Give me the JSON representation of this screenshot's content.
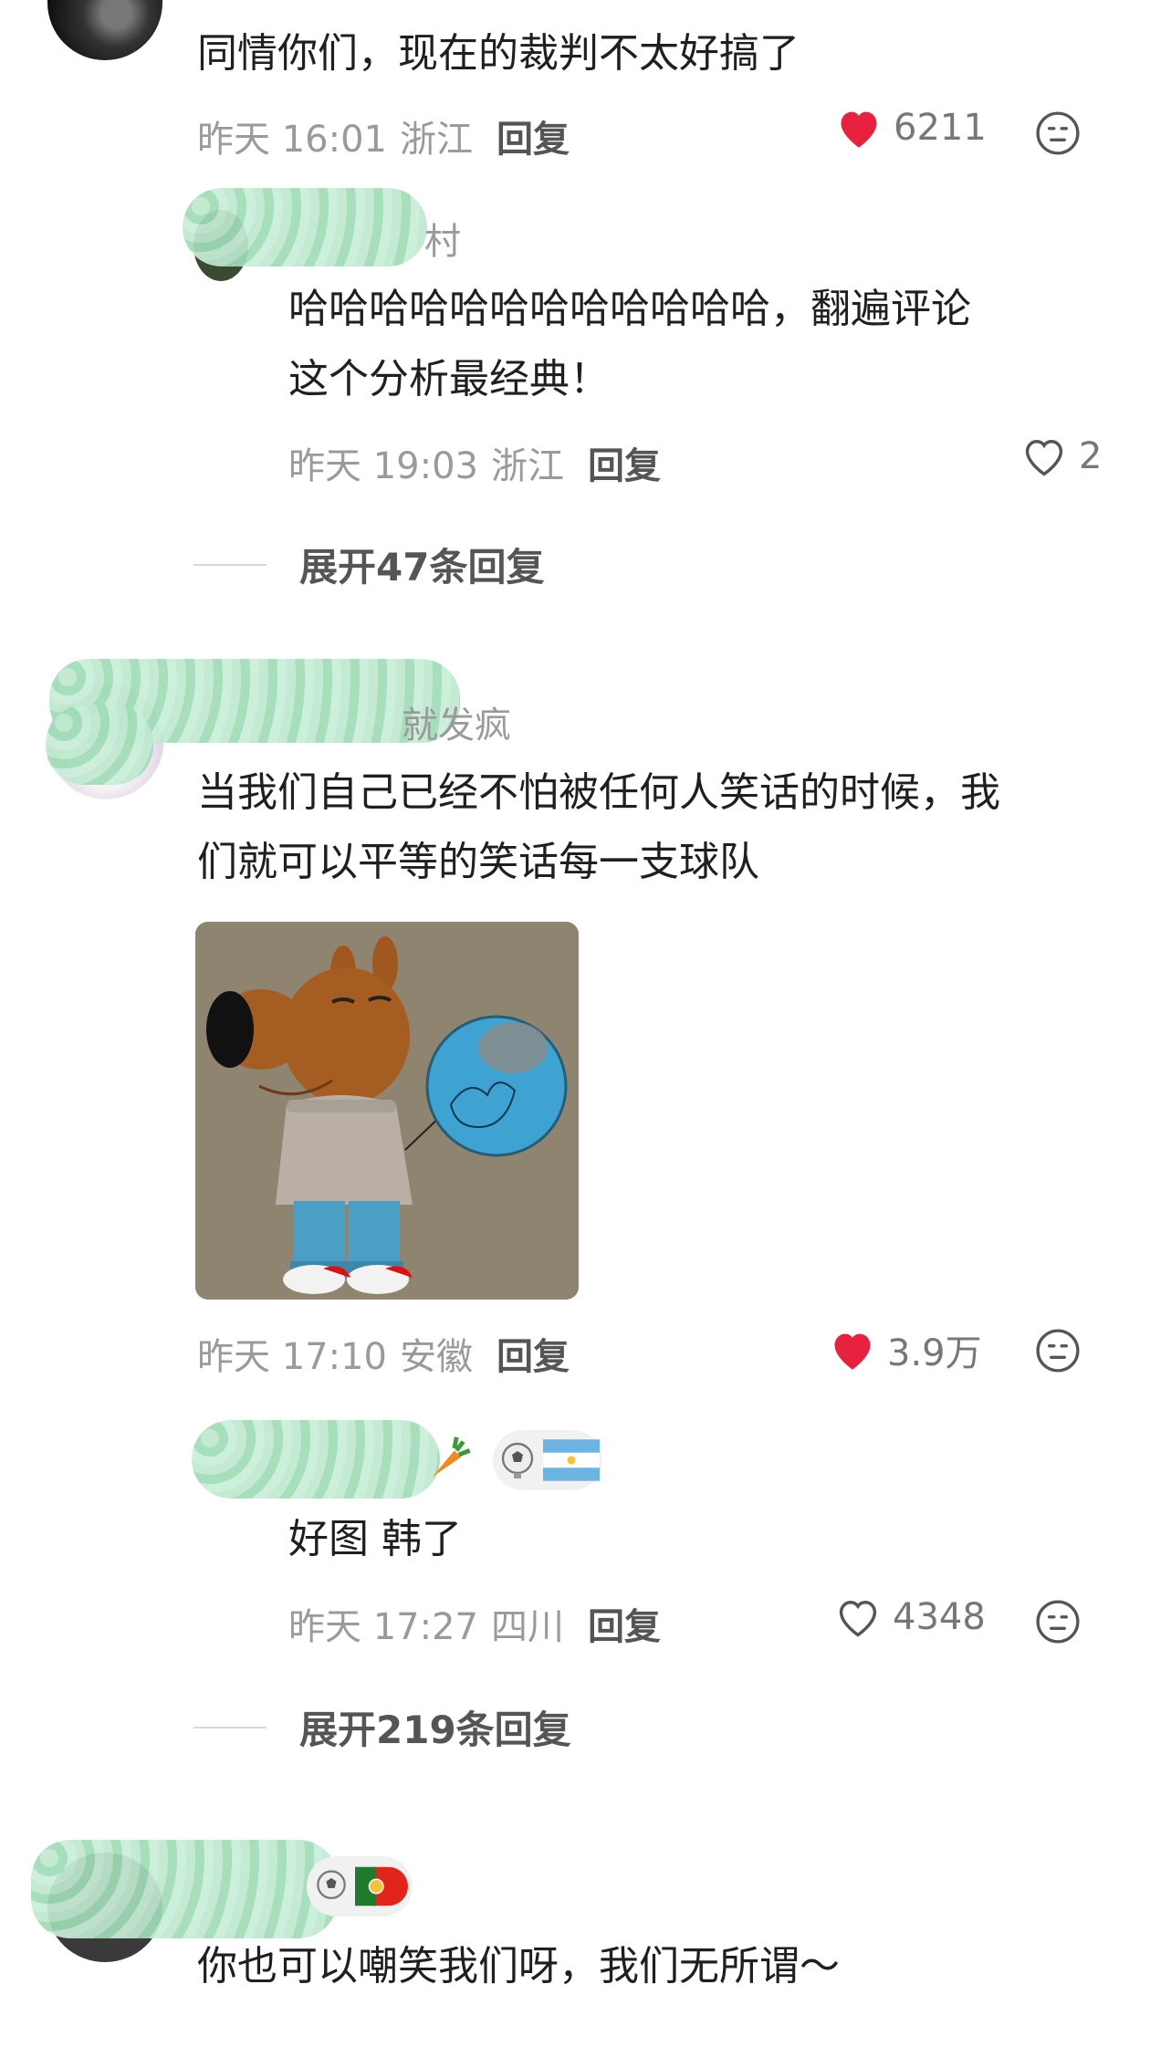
{
  "comments": [
    {
      "text": "同情你们，现在的裁判不太好搞了",
      "time": "昨天 16:01",
      "location": "浙江",
      "reply_label": "回复",
      "likes": "6211",
      "liked": true,
      "replies": [
        {
          "name_tail": "村",
          "text_line1": "哈哈哈哈哈哈哈哈哈哈哈哈，翻遍评论",
          "text_line2": "这个分析最经典！",
          "time": "昨天 19:03",
          "location": "浙江",
          "reply_label": "回复",
          "likes": "2",
          "liked": false
        }
      ],
      "expand_label": "展开47条回复"
    },
    {
      "name_tail": "就发疯",
      "text_line1": "当我们自己已经不怕被任何人笑话的时候，我",
      "text_line2": "们就可以平等的笑话每一支球队",
      "time": "昨天 17:10",
      "location": "安徽",
      "reply_label": "回复",
      "likes": "3.9万",
      "liked": true,
      "replies": [
        {
          "text": "好图 韩了",
          "time": "昨天 17:27",
          "location": "四川",
          "reply_label": "回复",
          "likes": "4348",
          "liked": false
        }
      ],
      "expand_label": "展开219条回复"
    },
    {
      "text": "你也可以嘲笑我们呀，我们无所谓～"
    }
  ],
  "colors": {
    "heart_red": "#e8213f",
    "meta_gray": "#9a9a9a",
    "blur_green": "#a8e0be"
  },
  "icons": {
    "emoji_button": "neutral-face-icon",
    "like_filled": "heart-filled-icon",
    "like_outline": "heart-outline-icon"
  }
}
